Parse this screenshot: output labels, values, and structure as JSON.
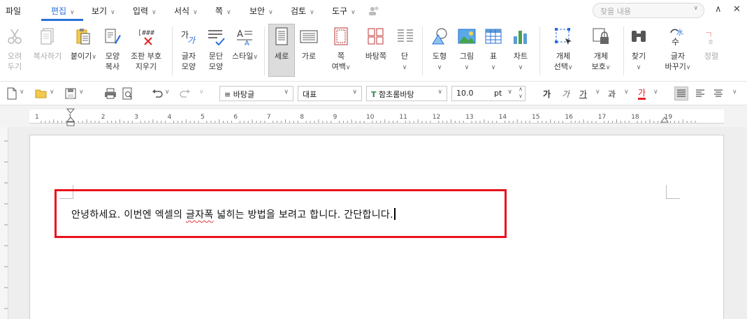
{
  "menu": {
    "file": "파일",
    "edit": "편집",
    "view": "보기",
    "input": "입력",
    "format": "서식",
    "page": "쪽",
    "security": "보안",
    "review": "검토",
    "tools": "도구"
  },
  "search": {
    "placeholder": "찾을 내용"
  },
  "ribbon": {
    "cut": [
      "오려",
      "두기"
    ],
    "copy": "복사하기",
    "paste": "붙이기",
    "format_copy": [
      "모양",
      "복사"
    ],
    "clear_code": [
      "조판 부호",
      "지우기"
    ],
    "char_shape": [
      "글자",
      "모양"
    ],
    "para_shape": [
      "문단",
      "모양"
    ],
    "style": "스타일",
    "portrait": "세로",
    "landscape": "가로",
    "page_margin": [
      "쪽",
      "여백"
    ],
    "background": "바탕쪽",
    "columns": "단",
    "shape": "도형",
    "picture": "그림",
    "table": "표",
    "chart": "차트",
    "object_select": [
      "개체",
      "선택"
    ],
    "object_protect": [
      "개체",
      "보호"
    ],
    "find": "찾기",
    "replace_char": [
      "글자",
      "바꾸기"
    ],
    "sort": "정렬"
  },
  "format_bar": {
    "style_value": "바탕글",
    "lang_value": "대표",
    "font_value": "함초롬바탕",
    "size_value": "10.0",
    "size_unit": "pt",
    "bold": "가",
    "italic": "가",
    "underline": "가",
    "strike": "과",
    "color": "가"
  },
  "ruler_marks": [
    "1",
    "1",
    "2",
    "3",
    "4",
    "5",
    "6",
    "7",
    "8",
    "9",
    "10",
    "11",
    "12",
    "13",
    "14",
    "15",
    "16",
    "17",
    "18",
    "19"
  ],
  "document": {
    "text_before": "안녕하세요. 이번엔 엑셀의 ",
    "text_misspelled": "글자폭",
    "text_after": " 넓히는 방법을 보려고 합니다. 간단합니다."
  },
  "colors": {
    "accent": "#2a6fdb",
    "highlight_border": "#e8121b"
  }
}
